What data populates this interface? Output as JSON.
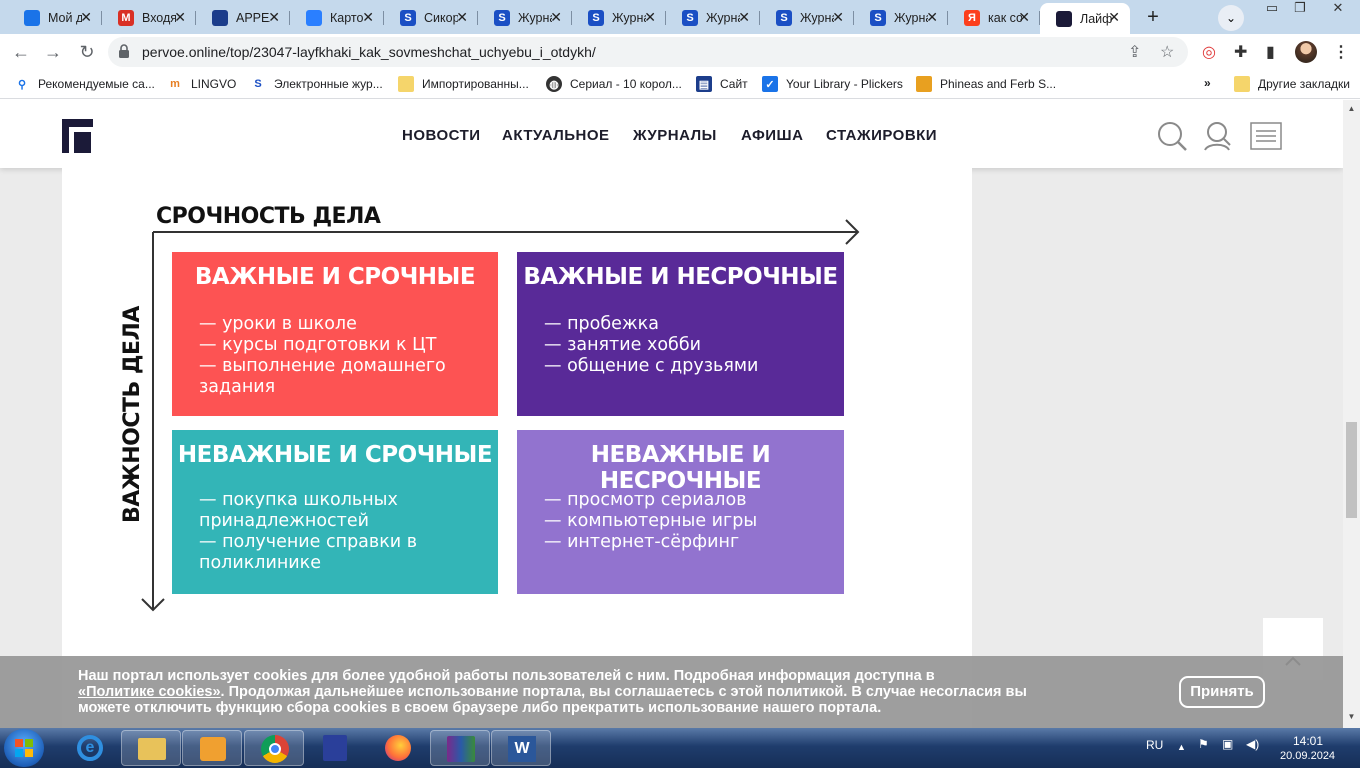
{
  "browser": {
    "tabs": [
      {
        "title": "Мой д",
        "icon": "google-drive-icon",
        "color": "#1a73e8"
      },
      {
        "title": "Входя",
        "icon": "gmail-icon",
        "color": "#d93025"
      },
      {
        "title": "APPEA",
        "icon": "calendar-app-icon",
        "color": "#1c3d8b"
      },
      {
        "title": "Карто",
        "icon": "search-q-icon",
        "color": "#2a7fff"
      },
      {
        "title": "Сикор",
        "icon": "s-logo-icon",
        "color": "#1b4fc4"
      },
      {
        "title": "Журна",
        "icon": "s-logo-icon",
        "color": "#1b4fc4"
      },
      {
        "title": "Журна",
        "icon": "s-logo-icon",
        "color": "#1b4fc4"
      },
      {
        "title": "Журна",
        "icon": "s-logo-icon",
        "color": "#1b4fc4"
      },
      {
        "title": "Журна",
        "icon": "s-logo-icon",
        "color": "#1b4fc4"
      },
      {
        "title": "Журна",
        "icon": "s-logo-icon",
        "color": "#1b4fc4"
      },
      {
        "title": "как со",
        "icon": "yandex-icon",
        "color": "#fc3f1d"
      },
      {
        "title": "Лайф",
        "icon": "pervoe-logo-icon",
        "color": "#1b1a38"
      }
    ],
    "url": "pervoe.online/top/23047-layfkhaki_kak_sovmeshchat_uchyebu_i_otdykh/",
    "bookmarks": [
      "Рекомендуемые са...",
      "LINGVO",
      "Электронные жур...",
      "Импортированны...",
      "Сериал - 10 корол...",
      "Сайт",
      "Your Library - Plickers",
      "Phineas and Ferb S..."
    ],
    "bookmarks_more": "»",
    "other_bookmarks": "Другие закладки"
  },
  "site": {
    "menu": [
      "НОВОСТИ",
      "АКТУАЛЬНОЕ",
      "ЖУРНАЛЫ",
      "АФИША",
      "СТАЖИРОВКИ"
    ]
  },
  "matrix": {
    "x_axis": "СРОЧНОСТЬ ДЕЛА",
    "y_axis": "ВАЖНОСТЬ ДЕЛА",
    "quadrants": [
      {
        "title": "ВАЖНЫЕ И СРОЧНЫЕ",
        "color": "#fd5353",
        "items": [
          "— уроки в школе",
          "— курсы подготовки к ЦТ",
          "— выполнение домашнего",
          "задания"
        ]
      },
      {
        "title": "ВАЖНЫЕ И НЕСРОЧНЫЕ",
        "color": "#592a98",
        "items": [
          "— пробежка",
          "— занятие хобби",
          "— общение с друзьями"
        ]
      },
      {
        "title": "НЕВАЖНЫЕ И СРОЧНЫЕ",
        "color": "#33b5b7",
        "items": [
          "— покупка школьных",
          "принадлежностей",
          "— получение справки в",
          "поликлинике"
        ]
      },
      {
        "title": "НЕВАЖНЫЕ И НЕСРОЧНЫЕ",
        "color": "#9273cf",
        "items": [
          "— просмотр сериалов",
          "— компьютерные игры",
          "— интернет-сёрфинг"
        ]
      }
    ]
  },
  "cookie": {
    "text1": "Наш портал использует cookies для более удобной работы пользователей с ним. Подробная информация доступна в",
    "link": "«Политике cookies»",
    "text2": ". Продолжая дальнейшее использование портала, вы соглашаетесь с этой политикой. В случае несогласия вы можете отключить функцию сбора cookies в своем браузере либо прекратить использование нашего портала.",
    "accept": "Принять"
  },
  "taskbar": {
    "lang": "RU",
    "time": "14:01",
    "date": "20.09.2024"
  }
}
